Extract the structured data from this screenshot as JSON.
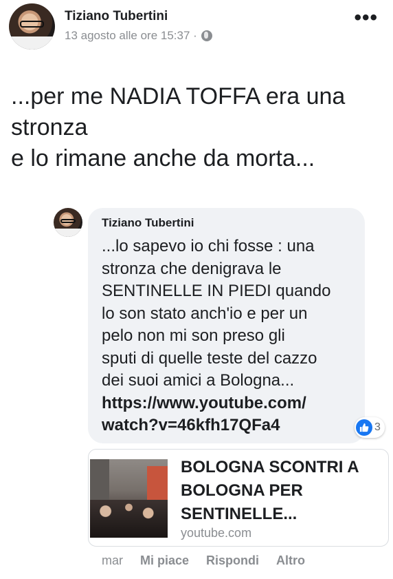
{
  "post": {
    "author": "Tiziano Tubertini",
    "timestamp": "13 agosto alle ore 15:37 ·",
    "privacy_icon": "globe-icon",
    "more_label": "•••",
    "text_lines": [
      "...per me NADIA TOFFA era una",
      "stronza",
      "e lo rimane anche da morta..."
    ]
  },
  "comment": {
    "author": "Tiziano Tubertini",
    "text_lines": [
      "...lo sapevo io chi fosse : una",
      "stronza che denigrava le",
      "SENTINELLE IN PIEDI quando",
      "lo son stato anch'io e per un",
      "pelo non mi son preso gli",
      "sputi di quelle teste del cazzo",
      "dei suoi amici a Bologna..."
    ],
    "link_lines": [
      "https://www.youtube.com/",
      "watch?v=46kfh17QFa4"
    ],
    "reaction_icon": "like-icon",
    "reaction_count": "3",
    "accent_color": "#1877f2"
  },
  "preview": {
    "title_lines": [
      "BOLOGNA SCONTRI A",
      "BOLOGNA PER",
      "SENTINELLE..."
    ],
    "domain": "youtube.com"
  },
  "actions": {
    "time": "mar",
    "like": "Mi piace",
    "reply": "Rispondi",
    "more": "Altro"
  }
}
